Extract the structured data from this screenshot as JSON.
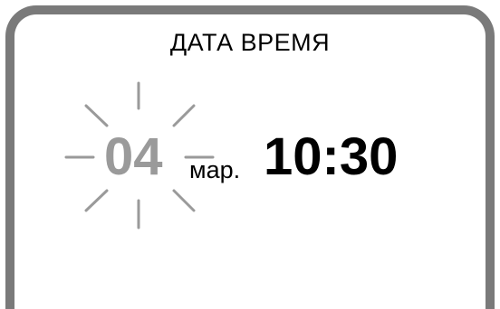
{
  "screen": {
    "title": "ДАТА ВРЕМЯ",
    "date": {
      "day": "04",
      "month": "мар.",
      "day_state": "blinking"
    },
    "time": "10:30"
  },
  "colors": {
    "frame": "#7a7a7a",
    "blinking_digit": "#9a9a9a",
    "text": "#000000"
  }
}
